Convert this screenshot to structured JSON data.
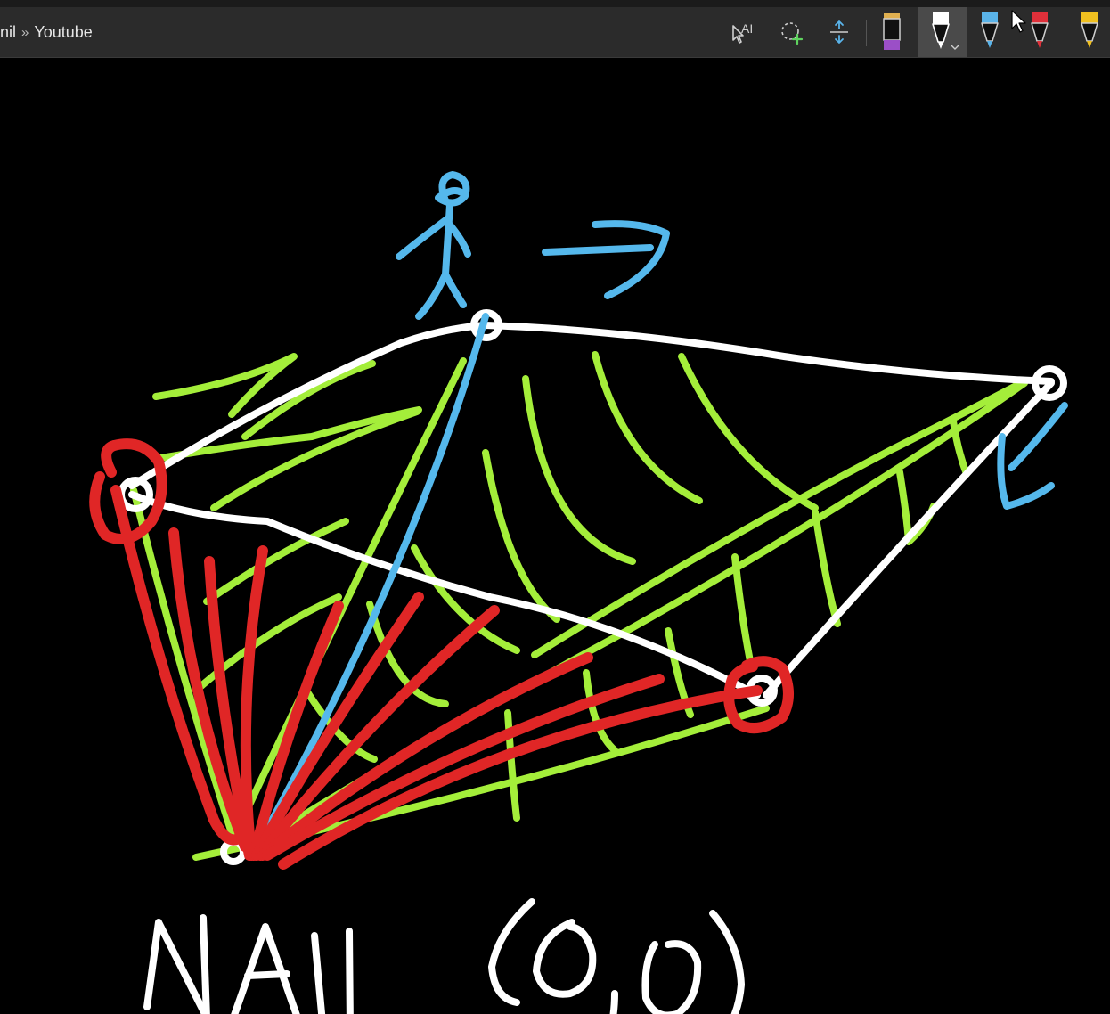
{
  "toolbar": {
    "breadcrumb": {
      "parent": "nil",
      "separator": "»",
      "current": "Youtube"
    },
    "tools": [
      {
        "name": "ink-to-text",
        "label": "AI"
      },
      {
        "name": "lasso-select"
      },
      {
        "name": "insert-space"
      }
    ],
    "pens": [
      {
        "name": "highlighter-purple",
        "color": "#9b4fc7",
        "cap": "#e0b050"
      },
      {
        "name": "pen-white",
        "color": "#ffffff",
        "selected": true
      },
      {
        "name": "pen-blue",
        "color": "#5ab4ea"
      },
      {
        "name": "pen-red",
        "color": "#e0303a"
      },
      {
        "name": "pen-yellow",
        "color": "#f0c020"
      }
    ]
  },
  "canvas": {
    "handwriting": "NAIL (0,0)",
    "ink_colors": {
      "white": "#ffffff",
      "green": "#a4ee3a",
      "red": "#e02626",
      "blue": "#55b8ec"
    }
  }
}
